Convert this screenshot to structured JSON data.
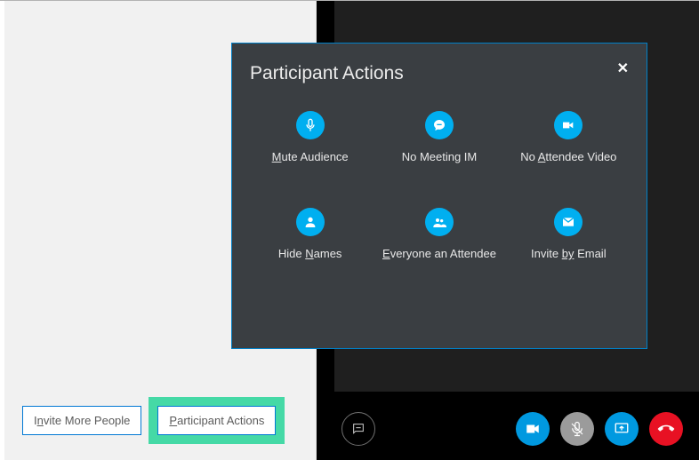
{
  "popover": {
    "title": "Participant Actions",
    "actions": {
      "mute": {
        "pre": "",
        "ul": "M",
        "post": "ute Audience"
      },
      "no_im": {
        "pre": "No Meeting IM",
        "ul": "",
        "post": ""
      },
      "no_video": {
        "pre": "No ",
        "ul": "A",
        "post": "ttendee Video"
      },
      "hide_names": {
        "pre": "Hide ",
        "ul": "N",
        "post": "ames"
      },
      "everyone": {
        "pre": "",
        "ul": "E",
        "post": "veryone an Attendee"
      },
      "invite_email": {
        "pre": "Invite ",
        "ul": "by",
        "post": " Email"
      }
    }
  },
  "left_buttons": {
    "invite": {
      "pre": "I",
      "ul": "n",
      "post": "vite More People"
    },
    "participant": {
      "pre": "",
      "ul": "P",
      "post": "articipant Actions"
    }
  },
  "colors": {
    "accent": "#00aff0",
    "highlight": "#45d9a6",
    "hangup": "#e81123"
  }
}
